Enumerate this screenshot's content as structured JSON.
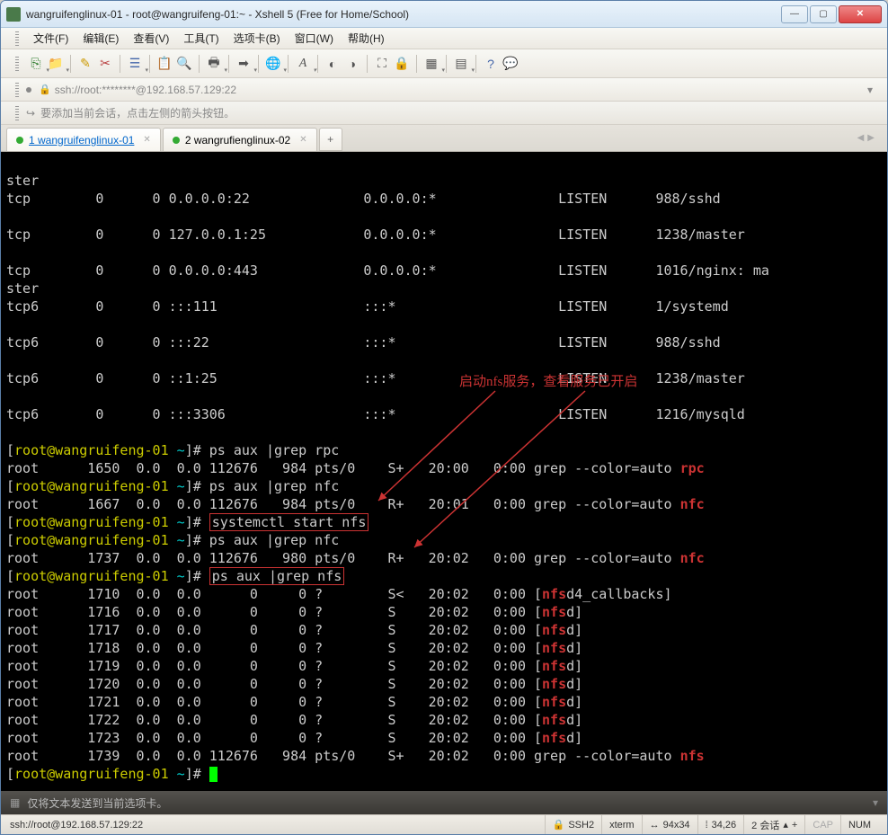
{
  "window": {
    "title": "wangruifenglinux-01 - root@wangruifeng-01:~ - Xshell 5 (Free for Home/School)"
  },
  "menu": {
    "file": "文件(F)",
    "edit": "编辑(E)",
    "view": "查看(V)",
    "tools": "工具(T)",
    "tabs": "选项卡(B)",
    "window": "窗口(W)",
    "help": "帮助(H)"
  },
  "addressbar": {
    "text": "ssh://root:********@192.168.57.129:22"
  },
  "hint": {
    "text": "要添加当前会话，点击左侧的箭头按钮。"
  },
  "tabs": {
    "t1": "1 wangruifenglinux-01",
    "t2": "2 wangrufienglinux-02",
    "add": "+"
  },
  "annotation": "启动nfs服务，查看服务已开启",
  "terminal_lines": {
    "l0": "ster",
    "l1": "tcp        0      0 0.0.0.0:22              0.0.0.0:*               LISTEN      988/sshd",
    "l2": "",
    "l3": "tcp        0      0 127.0.0.1:25            0.0.0.0:*               LISTEN      1238/master",
    "l4": "",
    "l5": "tcp        0      0 0.0.0.0:443             0.0.0.0:*               LISTEN      1016/nginx: ma",
    "l6": "ster",
    "l7": "tcp6       0      0 :::111                  :::*                    LISTEN      1/systemd",
    "l8": "",
    "l9": "tcp6       0      0 :::22                   :::*                    LISTEN      988/sshd",
    "l10": "",
    "l11": "tcp6       0      0 ::1:25                  :::*                    LISTEN      1238/master",
    "l12": "",
    "l13": "tcp6       0      0 :::3306                 :::*                    LISTEN      1216/mysqld",
    "l14": ""
  },
  "prompt": {
    "open": "[",
    "user_host": "root@wangruifeng-01",
    "path": " ~",
    "close": "]# "
  },
  "cmds": {
    "c1": "ps aux |grep rpc",
    "c2": "ps aux |grep nfc",
    "c3": "systemctl start nfs",
    "c4": "ps aux |grep nfc",
    "c5": "ps aux |grep nfs"
  },
  "out": {
    "rpc": {
      "pre": "root      1650  0.0  0.0 112676   984 pts/0    S+   20:00   0:00 grep --color=auto ",
      "kw": "rpc"
    },
    "nfc1": {
      "pre": "root      1667  0.0  0.0 112676   984 pts/0    R+   20:01   0:00 grep --color=auto ",
      "kw": "nfc"
    },
    "nfc2": {
      "pre": "root      1737  0.0  0.0 112676   980 pts/0    R+   20:02   0:00 grep --color=auto ",
      "kw": "nfc"
    },
    "nfs1": {
      "pre": "root      1710  0.0  0.0      0     0 ?        S<   20:02   0:00 [",
      "kw": "nfs",
      "post": "d4_callbacks]"
    },
    "nfs2": {
      "pre": "root      1716  0.0  0.0      0     0 ?        S    20:02   0:00 [",
      "kw": "nfs",
      "post": "d]"
    },
    "nfs3": {
      "pre": "root      1717  0.0  0.0      0     0 ?        S    20:02   0:00 [",
      "kw": "nfs",
      "post": "d]"
    },
    "nfs4": {
      "pre": "root      1718  0.0  0.0      0     0 ?        S    20:02   0:00 [",
      "kw": "nfs",
      "post": "d]"
    },
    "nfs5": {
      "pre": "root      1719  0.0  0.0      0     0 ?        S    20:02   0:00 [",
      "kw": "nfs",
      "post": "d]"
    },
    "nfs6": {
      "pre": "root      1720  0.0  0.0      0     0 ?        S    20:02   0:00 [",
      "kw": "nfs",
      "post": "d]"
    },
    "nfs7": {
      "pre": "root      1721  0.0  0.0      0     0 ?        S    20:02   0:00 [",
      "kw": "nfs",
      "post": "d]"
    },
    "nfs8": {
      "pre": "root      1722  0.0  0.0      0     0 ?        S    20:02   0:00 [",
      "kw": "nfs",
      "post": "d]"
    },
    "nfs9": {
      "pre": "root      1723  0.0  0.0      0     0 ?        S    20:02   0:00 [",
      "kw": "nfs",
      "post": "d]"
    },
    "nfs10": {
      "pre": "root      1739  0.0  0.0 112676   984 pts/0    S+   20:02   0:00 grep --color=auto ",
      "kw": "nfs",
      "post": ""
    }
  },
  "bottombar": {
    "text": "仅将文本发送到当前选项卡。"
  },
  "statusbar": {
    "conn": "ssh://root@192.168.57.129:22",
    "proto": "SSH2",
    "term": "xterm",
    "size": "94x34",
    "pos": "34,26",
    "sessions": "2 会话",
    "cap": "CAP",
    "num": "NUM",
    "lock_icon": "🔒",
    "size_icon": "↔",
    "pos_icon": "⁞"
  }
}
